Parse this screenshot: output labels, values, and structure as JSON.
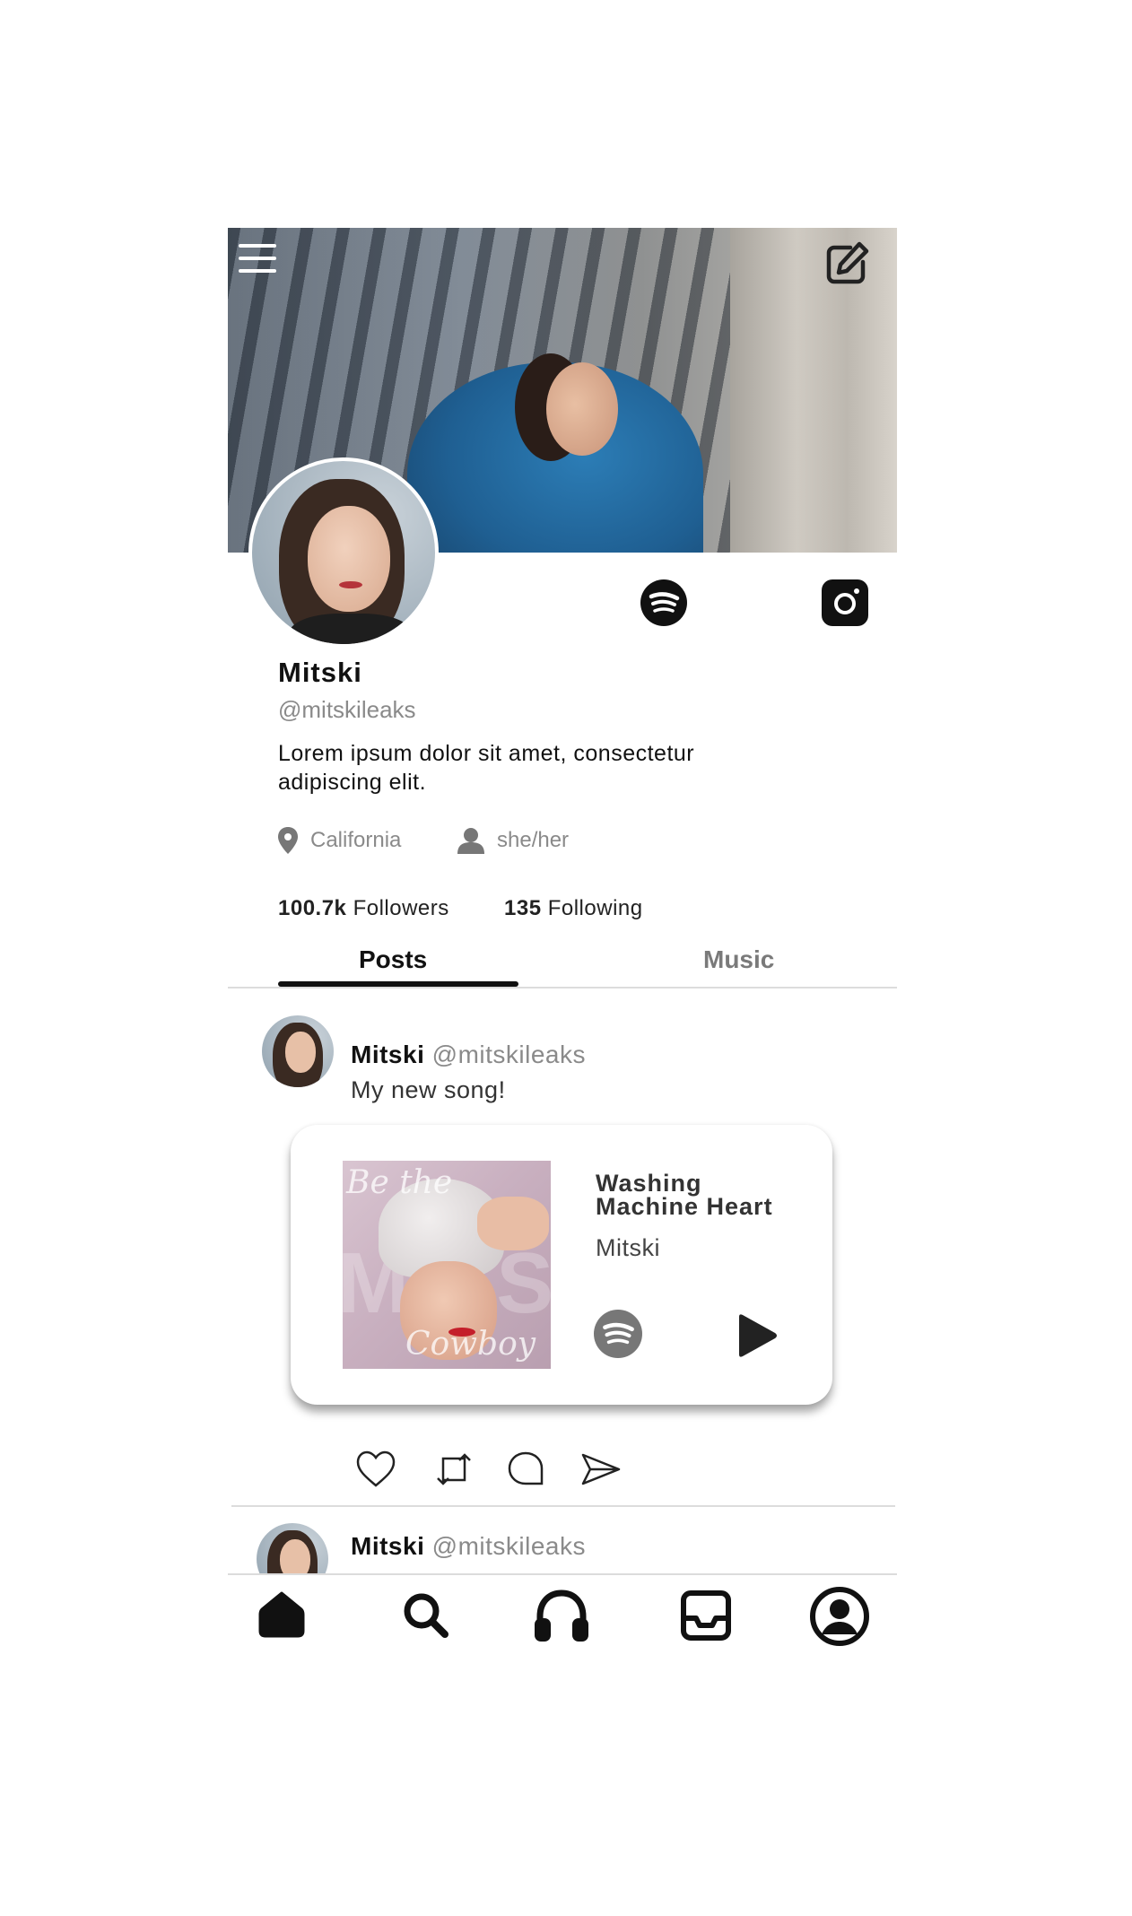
{
  "profile": {
    "name": "Mitski",
    "handle": "@mitskileaks",
    "bio": "Lorem ipsum dolor sit amet, consectetur adipiscing elit.",
    "location": "California",
    "pronouns": "she/her",
    "followers_count": "100.7k",
    "followers_label": "Followers",
    "following_count": "135",
    "following_label": "Following"
  },
  "header": {
    "menu_icon": "hamburger-icon",
    "edit_icon": "edit-icon"
  },
  "social": {
    "spotify_icon": "spotify-icon",
    "instagram_icon": "instagram-icon"
  },
  "tabs": [
    {
      "label": "Posts",
      "active": true
    },
    {
      "label": "Music",
      "active": false
    }
  ],
  "posts": [
    {
      "author": "Mitski",
      "handle": "@mitskileaks",
      "text": "My new song!",
      "music": {
        "title": "Washing Machine Heart",
        "artist": "Mitski",
        "album_art_text": [
          "Be the",
          "MITSKI",
          "Cowboy"
        ]
      }
    },
    {
      "author": "Mitski",
      "handle": "@mitskileaks"
    }
  ],
  "post_actions": [
    "heart-icon",
    "repost-icon",
    "comment-icon",
    "share-icon"
  ],
  "bottom_nav": [
    "home-icon",
    "search-icon",
    "headphones-icon",
    "inbox-icon",
    "profile-icon"
  ],
  "colors": {
    "text": "#111111",
    "muted": "#8a8a8a",
    "divider": "#dcdcdc",
    "spotify_gray": "#777777"
  }
}
